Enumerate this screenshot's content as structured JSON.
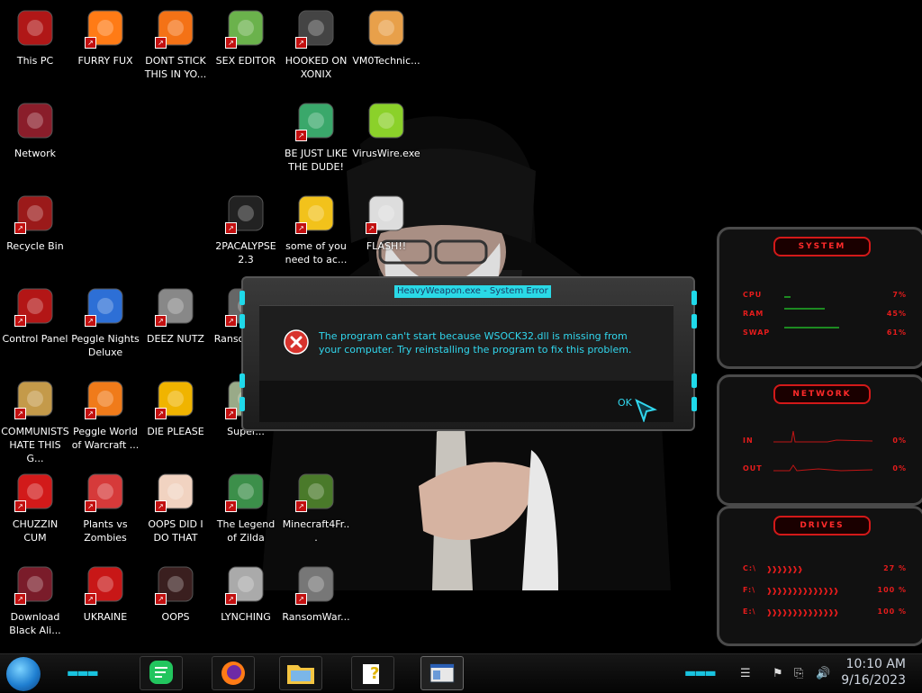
{
  "desktop_icons": [
    {
      "label": "This PC",
      "icon": "this-pc-icon"
    },
    {
      "label": "FURRY FUX",
      "icon": "firefox-icon"
    },
    {
      "label": "DONT STICK THIS IN YO...",
      "icon": "vlc-icon"
    },
    {
      "label": "SEX EDITOR",
      "icon": "hxd-icon"
    },
    {
      "label": "HOOKED ON XONIX",
      "icon": "xonix-icon"
    },
    {
      "label": "VM0Technic...",
      "icon": "doctor-icon"
    },
    {
      "label": "Network",
      "icon": "network-icon"
    },
    {
      "label": "BE JUST LIKE THE DUDE!",
      "icon": "elf-icon"
    },
    {
      "label": "VirusWire.exe",
      "icon": "limewire-icon"
    },
    {
      "label": "Recycle Bin",
      "icon": "recycle-bin-icon"
    },
    {
      "label": "2PACALYPSE 2.3",
      "icon": "cmd-icon"
    },
    {
      "label": "some of you need to ac...",
      "icon": "dog-icon"
    },
    {
      "label": "FLASH!!",
      "icon": "cards-icon"
    },
    {
      "label": "Control Panel",
      "icon": "control-panel-icon"
    },
    {
      "label": "Peggle Nights Deluxe",
      "icon": "peggle-icon"
    },
    {
      "label": "DEEZ NUTZ",
      "icon": "windows-stack-icon"
    },
    {
      "label": "Ranso Maker",
      "icon": "ransom-maker-icon"
    },
    {
      "label": "COMMUNISTS HATE THIS G...",
      "icon": "money-bag-icon"
    },
    {
      "label": "Peggle World of Warcraft ...",
      "icon": "peggle-wow-icon"
    },
    {
      "label": "DIE PLEASE",
      "icon": "de-icon"
    },
    {
      "label": "Super...",
      "icon": "super-icon"
    },
    {
      "label": "CHUZZIN CUM",
      "icon": "chuzzle-icon"
    },
    {
      "label": "Plants vs Zombies",
      "icon": "pvz-icon"
    },
    {
      "label": "OOPS DID I DO THAT",
      "icon": "portrait-icon"
    },
    {
      "label": "The Legend of Zilda",
      "icon": "zelda-icon"
    },
    {
      "label": "Minecraft4Fr...",
      "icon": "minecraft-icon"
    },
    {
      "label": "Download Black Ali...",
      "icon": "alien-icon"
    },
    {
      "label": "UKRAINE",
      "icon": "radiation-icon"
    },
    {
      "label": "OOPS",
      "icon": "computer-skull-icon"
    },
    {
      "label": "LYNCHING",
      "icon": "noose-icon"
    },
    {
      "label": "RansomWar...",
      "icon": "skull-icon"
    }
  ],
  "dialog": {
    "title": "HeavyWeapon.exe - System Error",
    "message": "The program can't start because WSOCK32.dll is missing from your computer. Try reinstalling the program to fix this problem.",
    "ok_label": "OK",
    "icon": "error-icon"
  },
  "widget": {
    "system": {
      "title": "SYSTEM",
      "rows": [
        {
          "label": "CPU",
          "value": "7%",
          "level": 0.07
        },
        {
          "label": "RAM",
          "value": "45%",
          "level": 0.45
        },
        {
          "label": "SWAP",
          "value": "61%",
          "level": 0.61
        }
      ]
    },
    "network": {
      "title": "NETWORK",
      "rows": [
        {
          "label": "IN",
          "value": "0%"
        },
        {
          "label": "OUT",
          "value": "0%"
        }
      ]
    },
    "drives": {
      "title": "DRIVES",
      "rows": [
        {
          "label": "C:\\",
          "value": "27 %"
        },
        {
          "label": "F:\\",
          "value": "100 %"
        },
        {
          "label": "E:\\",
          "value": "100 %"
        }
      ]
    },
    "accent_color": "#e51c1c"
  },
  "taskbar": {
    "apps": [
      {
        "name": "notes",
        "icon": "notes-icon"
      },
      {
        "name": "firefox",
        "icon": "firefox-icon"
      },
      {
        "name": "file-explorer",
        "icon": "folder-icon"
      },
      {
        "name": "help",
        "icon": "help-file-icon"
      },
      {
        "name": "window",
        "icon": "window-icon",
        "active": true
      }
    ],
    "clock_time": "10:10 AM",
    "clock_date": "9/16/2023"
  }
}
